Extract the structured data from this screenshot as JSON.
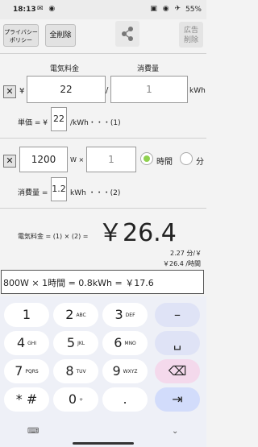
{
  "status": {
    "time": "18:13",
    "battery": "55%"
  },
  "toolbar": {
    "privacy_label": "プライバシー\nポリシー",
    "clear_all_label": "全削除",
    "share_icon": "share-icon",
    "ad_remove_label": "広告\n削除"
  },
  "calc": {
    "price_header": "電気料金",
    "usage_header": "消費量",
    "yen": "¥",
    "price_value": "22",
    "slash": "/",
    "usage_value": "1",
    "kwh": "kWh",
    "unit_price_label": "単価 = ¥",
    "unit_price_value": "22",
    "unit_price_suffix": "/kWh・・・(1)",
    "watt_value": "1200",
    "watt_unit": "W ×",
    "time_value": "1",
    "radio_hour": "時間",
    "radio_minute": "分",
    "consumption_label": "消費量 =",
    "consumption_value": "1.2",
    "consumption_suffix": "kWh ・・・(2)",
    "result_label": "電気料金 = (1) × (2) =",
    "result_value": "￥26.4",
    "per_minute": "2.27 分/￥",
    "per_hour": "￥26.4 /時間",
    "formula": "800W × 1時間 = 0.8kWh = ￥17.6"
  },
  "keyboard": {
    "rows": [
      [
        {
          "d": "1",
          "s": ""
        },
        {
          "d": "2",
          "s": "ABC"
        },
        {
          "d": "3",
          "s": "DEF"
        },
        {
          "d": "–",
          "s": ""
        }
      ],
      [
        {
          "d": "4",
          "s": "GHI"
        },
        {
          "d": "5",
          "s": "JKL"
        },
        {
          "d": "6",
          "s": "MNO"
        },
        {
          "d": "␣",
          "s": ""
        }
      ],
      [
        {
          "d": "7",
          "s": "PQRS"
        },
        {
          "d": "8",
          "s": "TUV"
        },
        {
          "d": "9",
          "s": "WXYZ"
        },
        {
          "d": "⌫",
          "s": ""
        }
      ],
      [
        {
          "d": "* #",
          "s": ""
        },
        {
          "d": "0",
          "s": "+"
        },
        {
          "d": ".",
          "s": ""
        },
        {
          "d": "⇥",
          "s": ""
        }
      ]
    ],
    "bottom_left": "⌨",
    "bottom_right": "⌄"
  }
}
